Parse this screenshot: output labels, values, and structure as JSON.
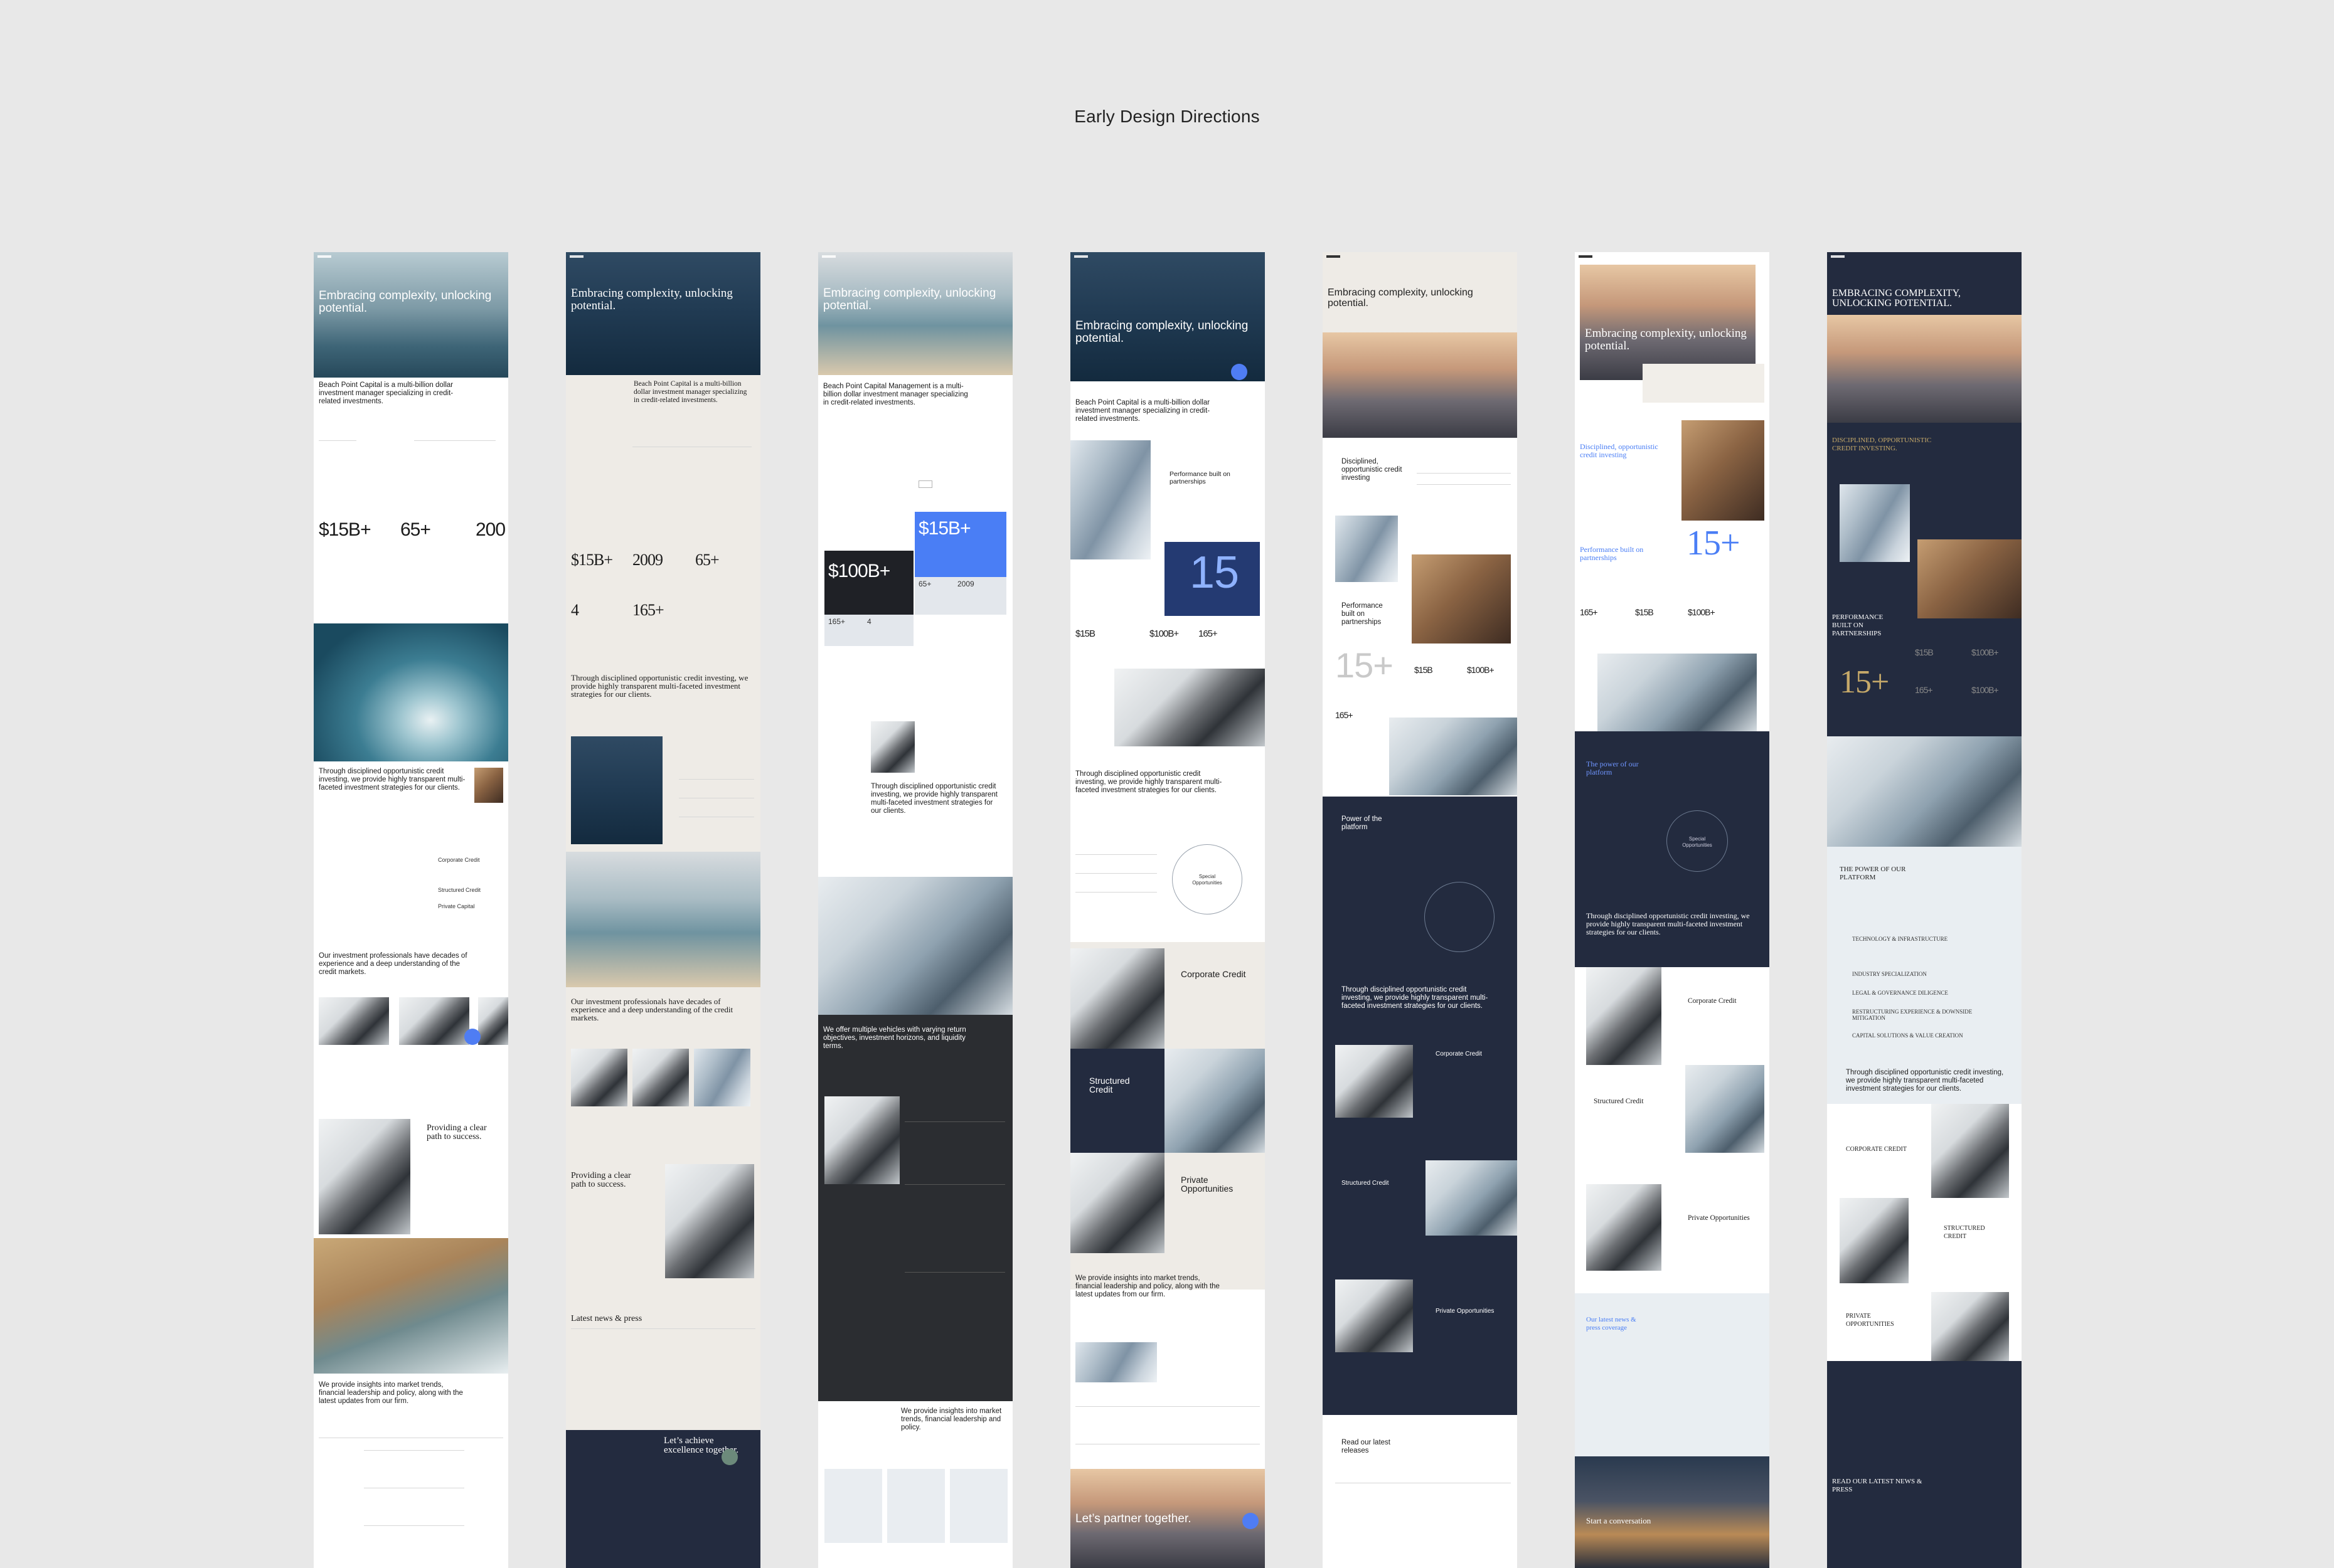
{
  "page": {
    "title": "Early Design Directions"
  },
  "col1": {
    "hero": "Embracing complexity, unlocking potential.",
    "intro": "Beach Point Capital is a multi-billion dollar investment manager specializing in credit-related investments.",
    "stats": [
      "$15B+",
      "65+",
      "200"
    ],
    "through": "Through disciplined opportunistic credit investing, we provide highly transparent multi-faceted investment strategies for our clients.",
    "list": [
      "Corporate Credit",
      "Structured Credit",
      "Private Capital"
    ],
    "pros": "Our investment professionals have decades of experience and a deep understanding of the credit markets.",
    "path": "Providing a clear path to success.",
    "insights": "We provide insights into market trends, financial leadership and policy, along with the latest updates from our firm."
  },
  "col2": {
    "hero": "Embracing complexity, unlocking potential.",
    "intro": "Beach Point Capital is a multi-billion dollar investment manager specializing in credit-related investments.",
    "stats": [
      "$15B+",
      "2009",
      "65+",
      "4",
      "165+"
    ],
    "through": "Through disciplined opportunistic credit investing, we provide highly transparent multi-faceted investment strategies for our clients.",
    "pros": "Our investment professionals have decades of experience and a deep understanding of the credit markets.",
    "path": "Providing a clear path to success.",
    "news": "Latest news & press",
    "cta": "Let’s achieve excellence together."
  },
  "col3": {
    "hero": "Embracing complexity, unlocking potential.",
    "intro": "Beach Point Capital Management is a multi-billion dollar investment manager specializing in credit-related investments.",
    "stats": [
      "$100B+",
      "$15B+",
      "65+",
      "2009",
      "165+",
      "4"
    ],
    "through": "Through disciplined opportunistic credit investing, we provide highly transparent multi-faceted investment strategies for our clients.",
    "vehicles": "We offer multiple vehicles with varying return objectives, investment horizons, and liquidity terms.",
    "insights": "We provide insights into market trends, financial leadership and policy."
  },
  "col4": {
    "hero": "Embracing complexity, unlocking potential.",
    "intro": "Beach Point Capital is a multi-billion dollar investment manager specializing in credit-related investments.",
    "perf": "Performance built on partnerships",
    "big": "15",
    "stats": [
      "$15B",
      "$100B+",
      "165+"
    ],
    "through": "Through disciplined opportunistic credit investing, we provide highly transparent multi-faceted investment strategies for our clients.",
    "special": "Special Opportunities",
    "corp": "Corporate Credit",
    "struct": "Structured Credit",
    "private": "Private Opportunities",
    "insights": "We provide insights into market trends, financial leadership and policy, along with the latest updates from our firm.",
    "cta": "Let’s partner together."
  },
  "col5": {
    "hero": "Embracing complexity, unlocking potential.",
    "disc": "Disciplined, opportunistic credit investing",
    "perf": "Performance built on partnerships",
    "big": "15+",
    "stats": [
      "$15B",
      "$100B+",
      "165+"
    ],
    "power": "Power of the platform",
    "through": "Through disciplined opportunistic credit investing, we provide highly transparent multi-faceted investment strategies for our clients.",
    "corp": "Corporate Credit",
    "struct": "Structured Credit",
    "private": "Private Opportunities",
    "read": "Read our latest releases"
  },
  "col6": {
    "hero": "Embracing complexity, unlocking potential.",
    "disc": "Disciplined, opportunistic credit investing",
    "perf": "Performance built on partnerships",
    "big": "15+",
    "stats": [
      "165+",
      "$15B",
      "$100B+"
    ],
    "power": "The power of our platform",
    "special": "Special Opportunities",
    "through": "Through disciplined opportunistic credit investing, we provide highly transparent multi-faceted investment strategies for our clients.",
    "corp": "Corporate Credit",
    "struct": "Structured Credit",
    "private": "Private Opportunities",
    "news": "Our latest news & press coverage",
    "start": "Start a conversation"
  },
  "col7": {
    "hero": "EMBRACING COMPLEXITY, UNLOCKING POTENTIAL.",
    "disc": "DISCIPLINED, OPPORTUNISTIC CREDIT INVESTING.",
    "perf": "PERFORMANCE BUILT ON PARTNERSHIPS",
    "big": "15+",
    "stats": [
      "$15B",
      "$100B+",
      "165+",
      "$100B+"
    ],
    "power": "THE POWER OF OUR PLATFORM",
    "list": [
      "TECHNOLOGY & INFRASTRUCTURE",
      "INDUSTRY SPECIALIZATION",
      "LEGAL & GOVERNANCE DILIGENCE",
      "RESTRUCTURING EXPERIENCE & DOWNSIDE MITIGATION",
      "CAPITAL SOLUTIONS & VALUE CREATION"
    ],
    "through": "Through disciplined opportunistic credit investing, we provide highly transparent multi-faceted investment strategies for our clients.",
    "corp": "CORPORATE CREDIT",
    "struct": "STRUCTURED CREDIT",
    "private": "PRIVATE OPPORTUNITIES",
    "news": "READ OUR LATEST NEWS & PRESS"
  },
  "colors": {
    "accent": "#4a7ef5",
    "navy": "#232b3f",
    "gold": "#c6a969",
    "bg": "#e8e8e8"
  }
}
